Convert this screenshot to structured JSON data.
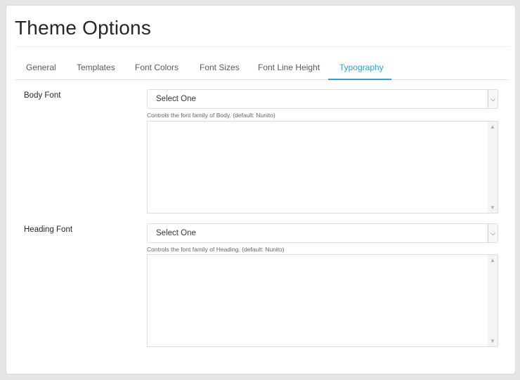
{
  "page": {
    "title": "Theme Options"
  },
  "tabs": [
    {
      "label": "General",
      "active": false
    },
    {
      "label": "Templates",
      "active": false
    },
    {
      "label": "Font Colors",
      "active": false
    },
    {
      "label": "Font Sizes",
      "active": false
    },
    {
      "label": "Font Line Height",
      "active": false
    },
    {
      "label": "Typography",
      "active": true
    }
  ],
  "fields": {
    "body_font": {
      "label": "Body Font",
      "selected": "Select One",
      "help": "Controls the font family of Body. (default: Nunito)"
    },
    "heading_font": {
      "label": "Heading Font",
      "selected": "Select One",
      "help": "Controls the font family of Heading. (default: Nunito)"
    }
  },
  "icons": {
    "select_arrow": "chevron-down-icon",
    "scroll_up": "scroll-up-arrow-icon",
    "scroll_down": "scroll-down-arrow-icon"
  },
  "colors": {
    "accent": "#2ea2cc",
    "background": "#e6e6e6",
    "panel": "#ffffff"
  }
}
